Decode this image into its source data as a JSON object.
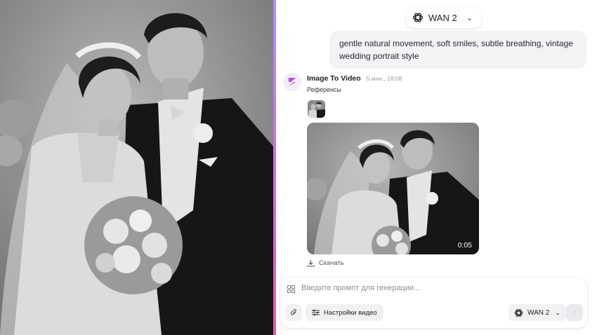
{
  "header": {
    "model_name": "WAN 2",
    "model_icon": "openai-knot-icon"
  },
  "user_message": {
    "text": "gentle natural movement, soft smiles, subtle breathing, vintage wedding portrait style"
  },
  "bot_message": {
    "name": "Image To Video",
    "time": "5 мин., 18:08",
    "references_label": "Референсы",
    "video_duration": "0:05",
    "download_label": "Скачать"
  },
  "composer": {
    "placeholder": "Введите промпт для генерации...",
    "settings_label": "Настройки видео",
    "model_name": "WAN 2"
  },
  "colors": {
    "accent_divider": "#c86ee6",
    "avatar_tint": "#b04cf0"
  }
}
